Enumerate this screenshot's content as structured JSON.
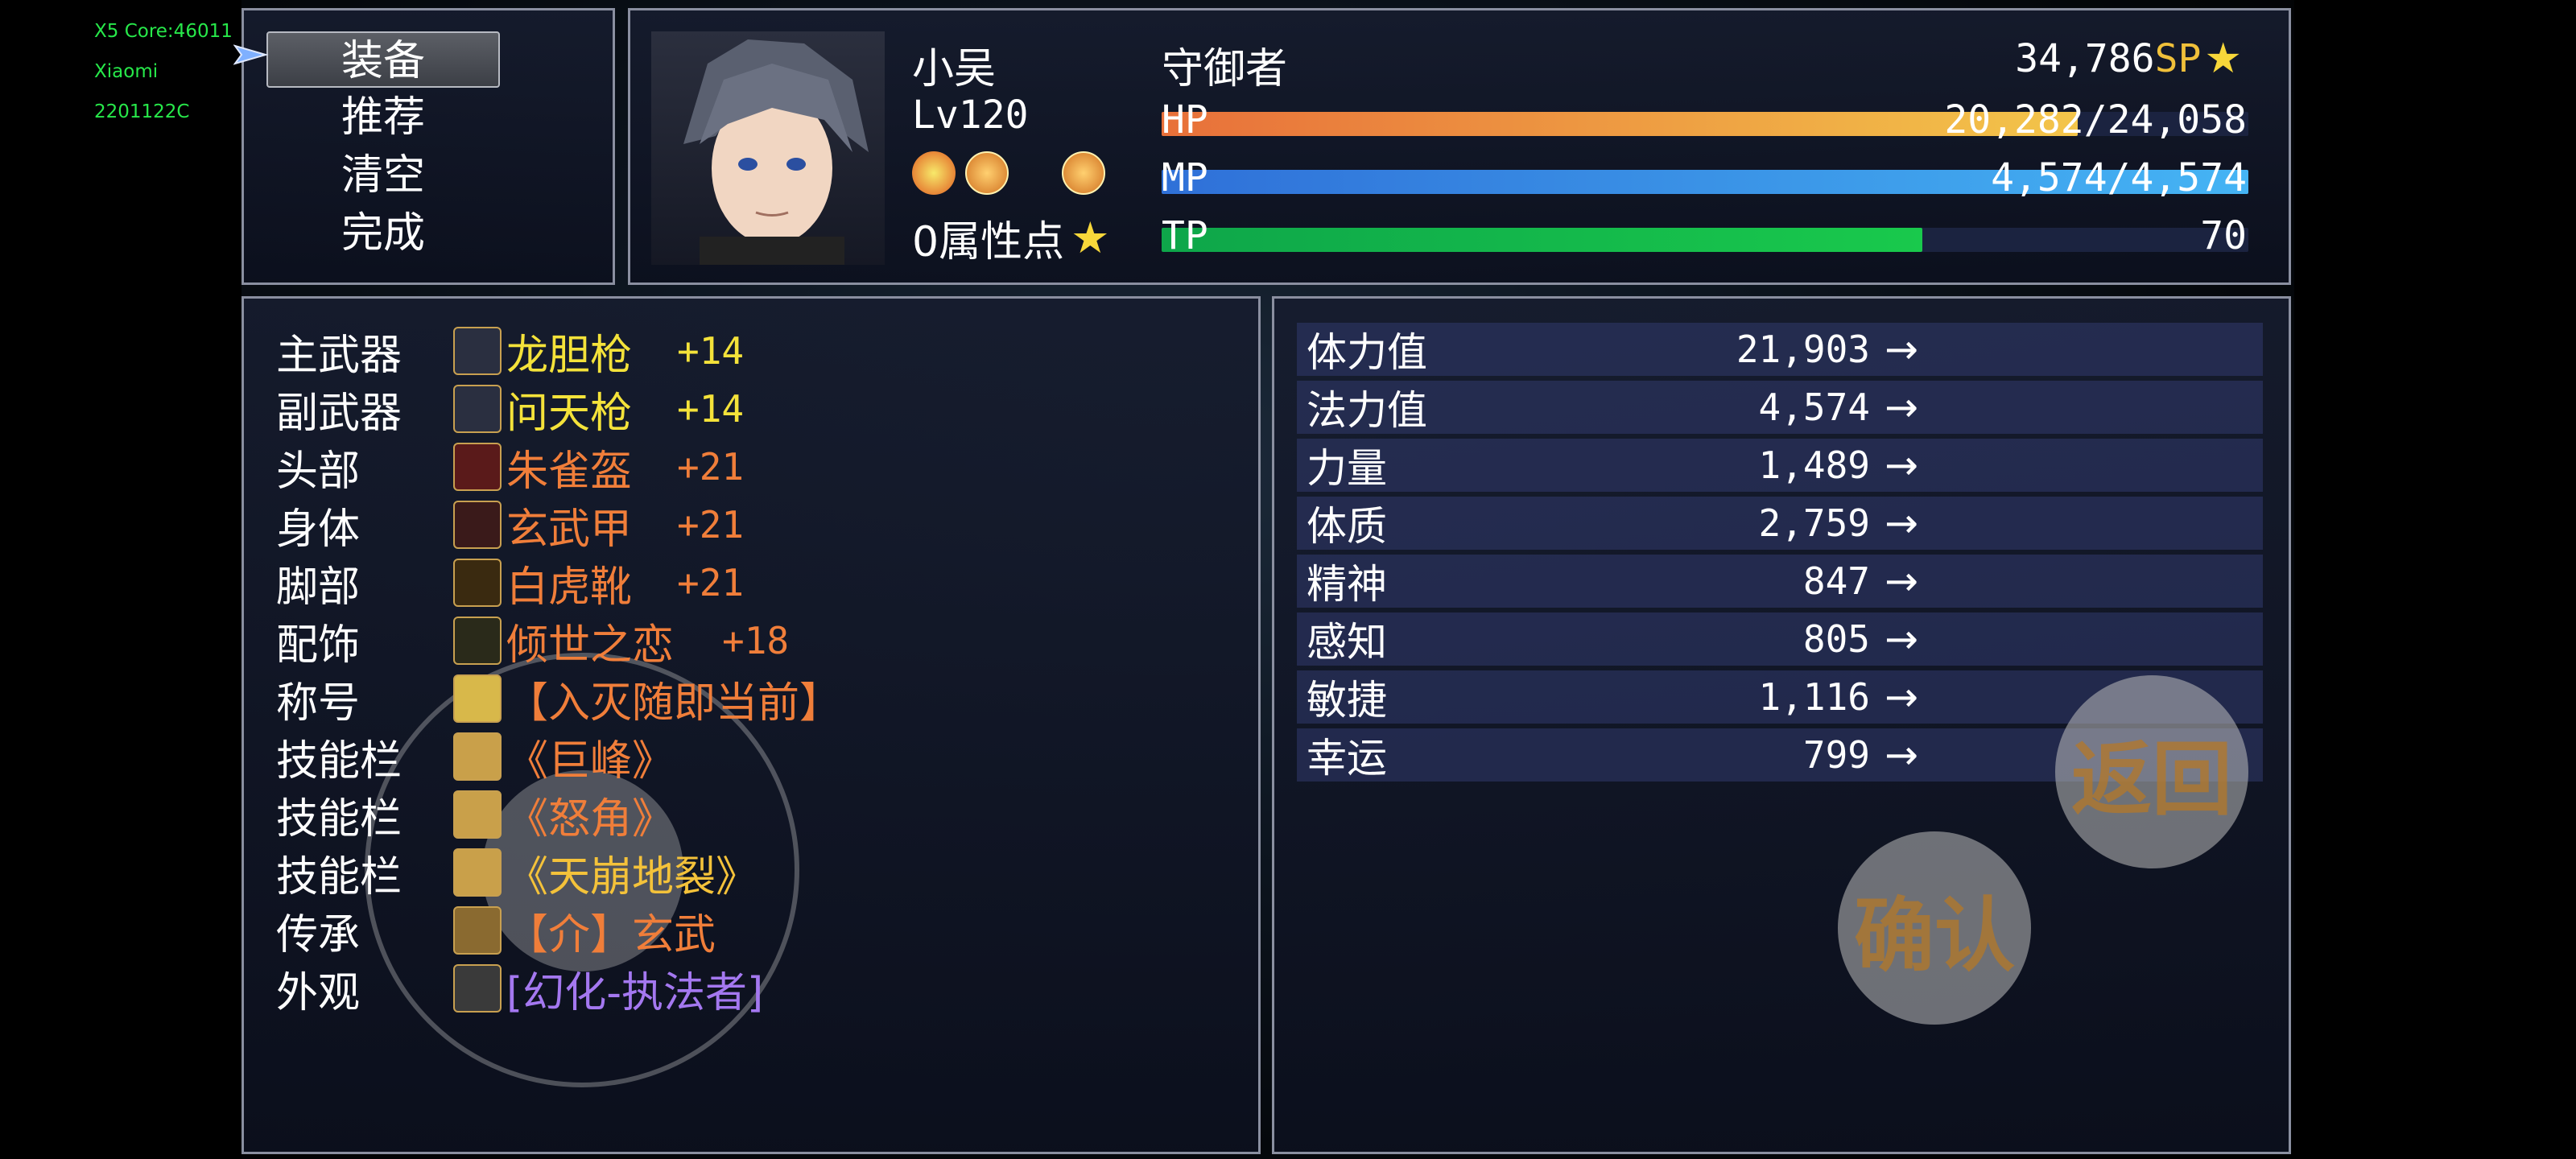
{
  "debug": [
    "X5 Core:46011",
    "Xiaomi",
    "2201122C"
  ],
  "menu": [
    "装备",
    "推荐",
    "清空",
    "完成"
  ],
  "actor": {
    "name": "小吴",
    "class": "守御者",
    "level": "Lv120",
    "sp": "34,786",
    "sp_label": "SP",
    "attr_points": "0属性点",
    "hp_label": "HP",
    "hp_text": "20,282/24,058",
    "hp_fraction": 0.843,
    "mp_label": "MP",
    "mp_text": "4,574/4,574",
    "mp_fraction": 1.0,
    "tp_label": "TP",
    "tp_text": "70",
    "tp_fraction": 0.7
  },
  "equipment": [
    {
      "slot": "主武器",
      "item": "龙胆枪",
      "plus": "+14",
      "color": "#f4e23a",
      "icon": "spear-icon"
    },
    {
      "slot": "副武器",
      "item": "问天枪",
      "plus": "+14",
      "color": "#f4e23a",
      "icon": "spear-icon"
    },
    {
      "slot": "头部",
      "item": "朱雀盔",
      "plus": "+21",
      "color": "#f07e3a",
      "icon": "helmet-icon"
    },
    {
      "slot": "身体",
      "item": "玄武甲",
      "plus": "+21",
      "color": "#f07e3a",
      "icon": "armor-icon"
    },
    {
      "slot": "脚部",
      "item": "白虎靴",
      "plus": "+21",
      "color": "#f07e3a",
      "icon": "boots-icon"
    },
    {
      "slot": "配饰",
      "item": "倾世之恋",
      "plus": "+18",
      "color": "#f07e3a",
      "icon": "accessory-icon"
    },
    {
      "slot": "称号",
      "item": "【入灭随即当前】",
      "plus": "",
      "color": "#f07e3a",
      "icon": "title-icon"
    },
    {
      "slot": "技能栏",
      "item": "《巨峰》",
      "plus": "",
      "color": "#f07e3a",
      "icon": "skill-icon"
    },
    {
      "slot": "技能栏",
      "item": "《怒角》",
      "plus": "",
      "color": "#f07e3a",
      "icon": "skill-icon"
    },
    {
      "slot": "技能栏",
      "item": "《天崩地裂》",
      "plus": "",
      "color": "#f4c23a",
      "icon": "skill-icon"
    },
    {
      "slot": "传承",
      "item": "【介】玄武",
      "plus": "",
      "color": "#f07e3a",
      "icon": "inherit-icon"
    },
    {
      "slot": "外观",
      "item": "[幻化-执法者]",
      "plus": "",
      "color": "#a478f0",
      "icon": "costume-icon"
    }
  ],
  "stats": [
    {
      "name": "体力值",
      "value": "21,903"
    },
    {
      "name": "法力值",
      "value": "4,574"
    },
    {
      "name": "力量",
      "value": "1,489"
    },
    {
      "name": "体质",
      "value": "2,759"
    },
    {
      "name": "精神",
      "value": "847"
    },
    {
      "name": "感知",
      "value": "805"
    },
    {
      "name": "敏捷",
      "value": "1,116"
    },
    {
      "name": "幸运",
      "value": "799"
    }
  ],
  "arrow": "→",
  "buttons": {
    "back": "返回",
    "confirm": "确认"
  },
  "colors": {
    "hp": "#f0b040",
    "mp": "#3aa4f0",
    "tp": "#17c24e",
    "sp_text": "#f0c03a"
  }
}
